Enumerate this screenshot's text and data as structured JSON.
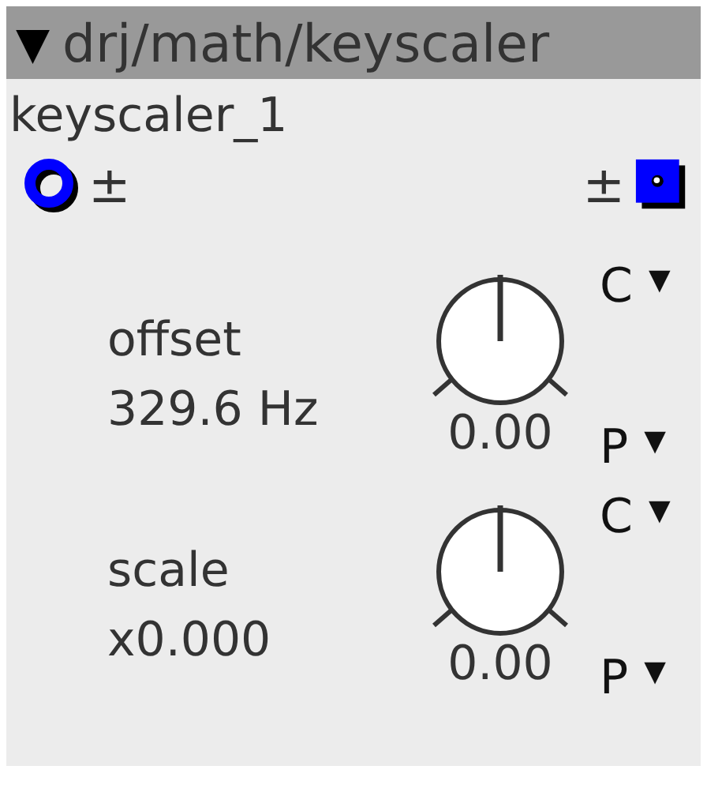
{
  "object": {
    "title_marker": "▼",
    "title": "drj/math/keyscaler",
    "instance": "keyscaler_1"
  },
  "inlet": {
    "symbol": "±"
  },
  "outlet": {
    "symbol": "±"
  },
  "params": [
    {
      "label": "offset",
      "reading": "329.6 Hz",
      "value": "0.00",
      "top_menu": "C",
      "bottom_menu": "P",
      "arrow": "▼"
    },
    {
      "label": "scale",
      "reading": "x0.000",
      "value": "0.00",
      "top_menu": "C",
      "bottom_menu": "P",
      "arrow": "▼"
    }
  ]
}
